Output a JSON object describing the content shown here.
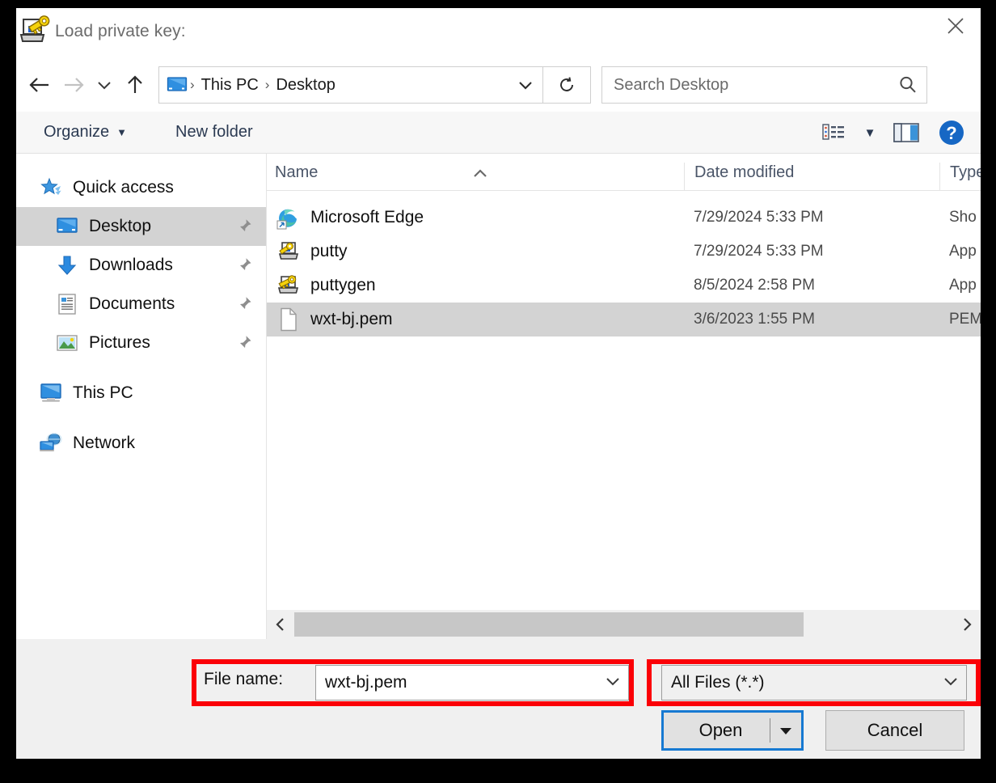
{
  "window": {
    "title": "Load private key:",
    "app_icon": "puttygen-key-icon",
    "close_label": "✕"
  },
  "nav": {
    "back_icon": "back-arrow-icon",
    "forward_icon": "forward-arrow-icon",
    "recent_icon": "chevron-down-icon",
    "up_icon": "up-arrow-icon",
    "breadcrumb": {
      "icon": "desktop-monitor-icon",
      "items": [
        "This PC",
        "Desktop"
      ],
      "separator": "›"
    },
    "address_chevron_icon": "chevron-down-icon",
    "refresh_icon": "refresh-icon",
    "search": {
      "placeholder": "Search Desktop",
      "icon": "search-icon"
    }
  },
  "toolbar": {
    "organize_label": "Organize",
    "organize_caret": "▼",
    "new_folder_label": "New folder",
    "view_icon": "list-view-icon",
    "view_caret": "▼",
    "preview_icon": "preview-pane-icon",
    "help_icon": "help-question-icon",
    "help_glyph": "?"
  },
  "sidebar": {
    "items": [
      {
        "label": "Quick access",
        "icon": "star-quick-access-icon",
        "indent": false,
        "pinned": false,
        "selected": false
      },
      {
        "label": "Desktop",
        "icon": "desktop-monitor-icon",
        "indent": true,
        "pinned": true,
        "selected": true
      },
      {
        "label": "Downloads",
        "icon": "download-arrow-icon",
        "indent": true,
        "pinned": true,
        "selected": false
      },
      {
        "label": "Documents",
        "icon": "documents-icon",
        "indent": true,
        "pinned": true,
        "selected": false
      },
      {
        "label": "Pictures",
        "icon": "pictures-icon",
        "indent": true,
        "pinned": true,
        "selected": false
      },
      {
        "label": "This PC",
        "icon": "this-pc-icon",
        "indent": false,
        "pinned": false,
        "selected": false
      },
      {
        "label": "Network",
        "icon": "network-icon",
        "indent": false,
        "pinned": false,
        "selected": false
      }
    ]
  },
  "filelist": {
    "columns": [
      "Name",
      "Date modified",
      "Type"
    ],
    "sort_column": "Name",
    "sort_direction": "ascending",
    "sort_glyph": "⌃",
    "rows": [
      {
        "name": "Microsoft Edge",
        "date": "7/29/2024 5:33 PM",
        "type": "Sho",
        "icon": "edge-shortcut-icon",
        "selected": false
      },
      {
        "name": "putty",
        "date": "7/29/2024 5:33 PM",
        "type": "App",
        "icon": "putty-icon",
        "selected": false
      },
      {
        "name": "puttygen",
        "date": "8/5/2024 2:58 PM",
        "type": "App",
        "icon": "puttygen-key-icon",
        "selected": false
      },
      {
        "name": "wxt-bj.pem",
        "date": "3/6/2023 1:55 PM",
        "type": "PEM",
        "icon": "generic-file-icon",
        "selected": true
      }
    ],
    "scrollbar": {
      "left_arrow": "‹",
      "right_arrow": "›"
    }
  },
  "bottom": {
    "filename_label": "File name:",
    "filename_value": "wxt-bj.pem",
    "filename_chevron_icon": "chevron-down-icon",
    "filter_value": "All Files (*.*)",
    "filter_chevron_icon": "chevron-down-icon",
    "open_label": "Open",
    "open_dropdown_glyph": "▼",
    "cancel_label": "Cancel"
  },
  "annotations": {
    "highlight_color": "#fb0007",
    "boxes": [
      "file-name-field",
      "file-type-filter"
    ]
  },
  "colors": {
    "accent_blue": "#1679d2",
    "selection_gray": "#d3d3d3",
    "chrome_gray": "#f0f0f0",
    "toolbar_gray": "#f7f7f7"
  }
}
